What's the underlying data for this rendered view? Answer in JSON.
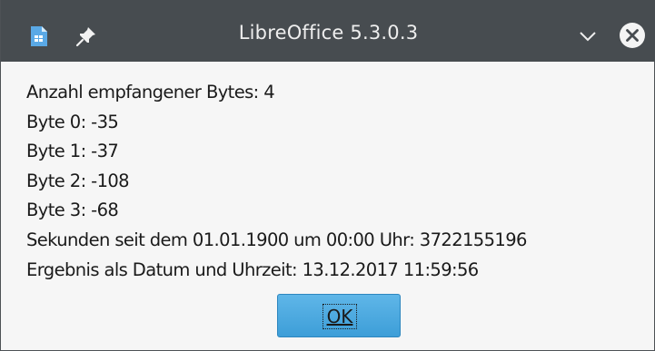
{
  "window": {
    "title": "LibreOffice 5.3.0.3",
    "icons": {
      "app": "libreoffice-document-icon",
      "pin": "pin-icon",
      "minimize": "chevron-down-icon",
      "close": "close-circle-icon"
    },
    "colors": {
      "titlebar": "#474c50",
      "button": "#4aa8e0"
    }
  },
  "dialog": {
    "lines": [
      "Anzahl empfangener Bytes: 4",
      "Byte 0: -35",
      "Byte 1: -37",
      "Byte 2: -108",
      "Byte 3: -68",
      "Sekunden seit dem 01.01.1900 um 00:00 Uhr: 3722155196",
      "Ergebnis als Datum und Uhrzeit: 13.12.2017 11:59:56"
    ],
    "ok_label": "OK"
  }
}
